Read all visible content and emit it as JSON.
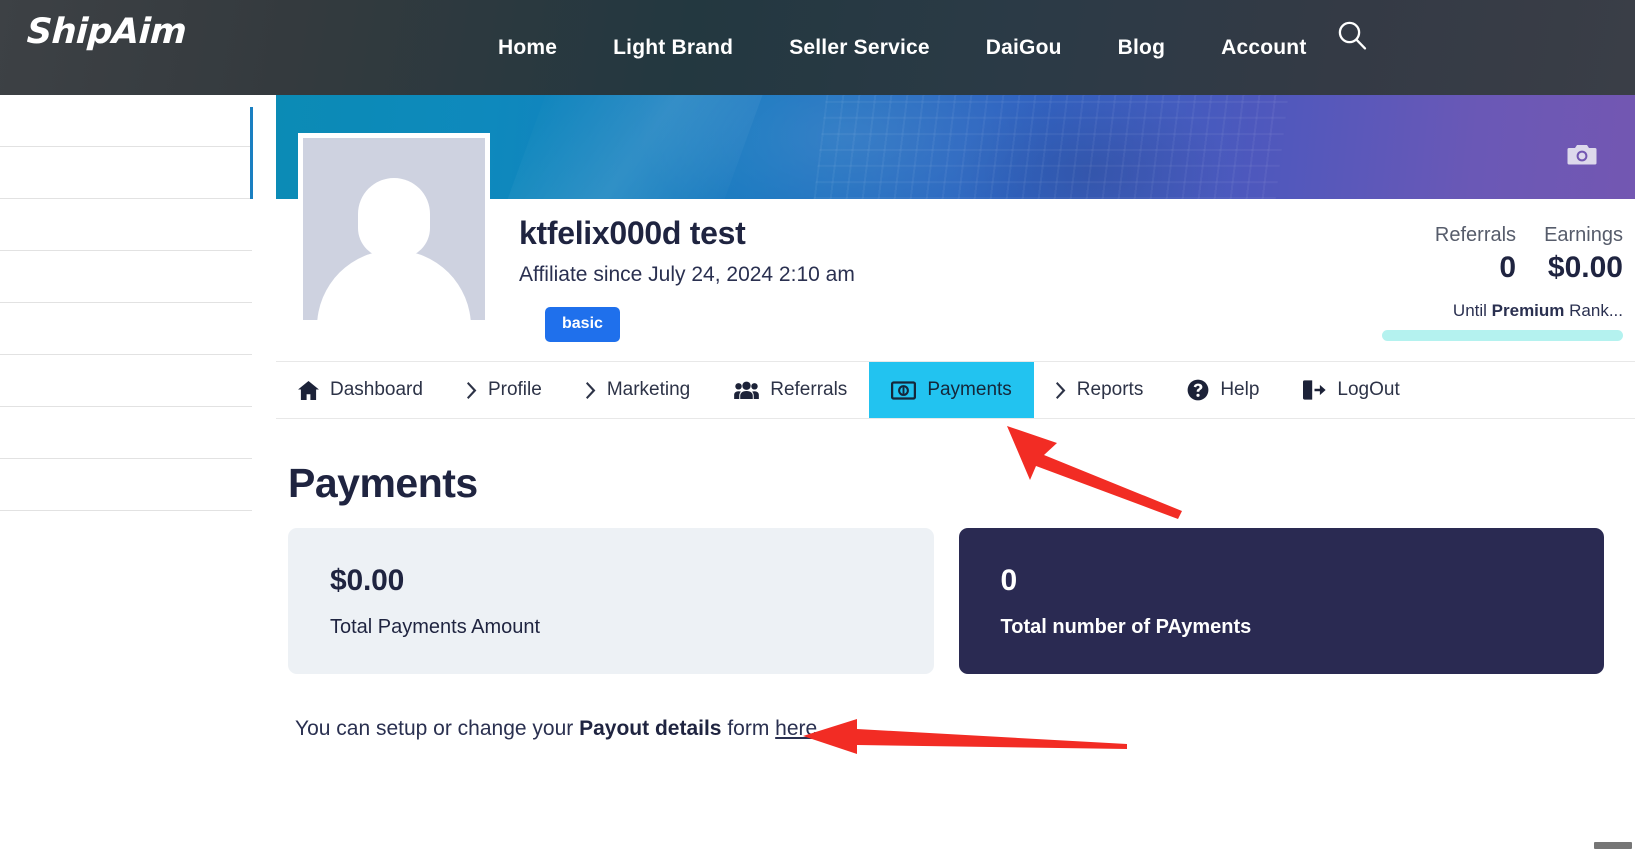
{
  "site": {
    "brand": "ShipAim",
    "nav": [
      {
        "label": "Home"
      },
      {
        "label": "Light Brand"
      },
      {
        "label": "Seller Service"
      },
      {
        "label": "DaiGou"
      },
      {
        "label": "Blog"
      },
      {
        "label": "Account"
      }
    ],
    "search_icon": "search-icon"
  },
  "profile": {
    "name": "ktfelix000d test",
    "since": "Affiliate since July 24, 2024 2:10 am",
    "badge": "basic",
    "camera_icon": "camera-icon",
    "avatar_alt": "default-avatar"
  },
  "stats": {
    "referrals_label": "Referrals",
    "referrals_value": "0",
    "earnings_label": "Earnings",
    "earnings_value": "$0.00",
    "rank_prefix": "Until ",
    "rank_name": "Premium",
    "rank_suffix": " Rank...",
    "rank_progress_color": "#b4f2ef"
  },
  "tabs": [
    {
      "label": "Dashboard",
      "icon": "home-icon",
      "active": false
    },
    {
      "label": "Profile",
      "icon": "chevron-right-icon",
      "active": false
    },
    {
      "label": "Marketing",
      "icon": "chevron-right-icon",
      "active": false
    },
    {
      "label": "Referrals",
      "icon": "users-icon",
      "active": false
    },
    {
      "label": "Payments",
      "icon": "money-icon",
      "active": true
    },
    {
      "label": "Reports",
      "icon": "chevron-right-icon",
      "active": false
    },
    {
      "label": "Help",
      "icon": "question-circle-icon",
      "active": false
    },
    {
      "label": "LogOut",
      "icon": "logout-icon",
      "active": false
    }
  ],
  "page": {
    "title": "Payments",
    "cards": [
      {
        "value": "$0.00",
        "caption": "Total Payments Amount",
        "theme": "light",
        "bg": "#edf1f5"
      },
      {
        "value": "0",
        "caption": "Total number of PAyments",
        "theme": "dark",
        "bg": "#2a2a52"
      }
    ],
    "payout_text_before": "You can setup or change your ",
    "payout_text_bold": "Payout details",
    "payout_text_mid": " form ",
    "payout_link": "here"
  },
  "annotations": {
    "accent_color": "#f22c24",
    "arrow_1": "arrow-pointing-to-payments-tab",
    "arrow_2": "arrow-pointing-to-here-link"
  },
  "theme": {
    "tab_active_bg": "#22c3f0",
    "badge_bg": "#1f70ec",
    "dark_card_bg": "#2a2a52",
    "light_card_bg": "#edf1f5",
    "nav_bg": "#343a3e"
  }
}
